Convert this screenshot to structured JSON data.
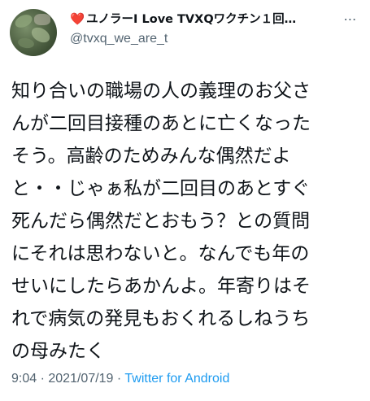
{
  "tweet": {
    "display_name": "ユノラーI Love TVXQワクチン１回…",
    "handle": "@tvxq_we_are_t",
    "more_icon": "⋯",
    "heart_icon": "❤️",
    "body_lines": [
      "知り合いの職場の人の義理のお父さ",
      "んが二回目接種のあとに亡くなった",
      "そう。高齢のためみんな偶然だよ",
      "と・・じゃぁ私が二回目のあとすぐ",
      "死んだら偶然だとおもう？との質問",
      "にそれは思わないと。なんでも年の",
      "せいにしたらあかんよ。年寄りはそ",
      "れで病気の発見もおくれるしねうち",
      "の母みたく"
    ],
    "time": "9:04",
    "separator": "·",
    "date": "2021/07/19",
    "source": "Twitter for Android"
  }
}
